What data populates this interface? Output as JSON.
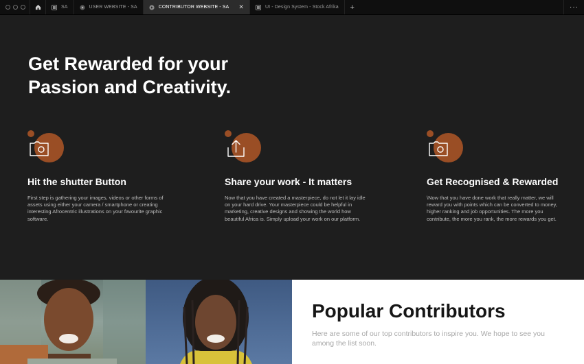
{
  "tabbar": {
    "tabs": [
      {
        "label": "SA",
        "icon": "figma-file-icon",
        "active": false
      },
      {
        "label": "USER WEBSITE - SA",
        "icon": "play-icon",
        "active": false
      },
      {
        "label": "CONTRIBUTOR WEBSITE - SA",
        "icon": "play-icon",
        "active": true
      },
      {
        "label": "UI - Design System - Stock Afrika",
        "icon": "figma-file-icon",
        "active": false
      }
    ],
    "new_tab": "+",
    "more": "···"
  },
  "hero": {
    "title_line1": "Get Rewarded for your",
    "title_line2": "Passion and Creativity.",
    "accent_color": "#9a4e25"
  },
  "features": [
    {
      "icon": "camera-icon",
      "title": "Hit the shutter Button",
      "text": "First step is gathering your images, videos or other forms of assets using either your camera / smartphone or creating interesting Afrocentric illustrations on your favourite graphic software."
    },
    {
      "icon": "upload-icon",
      "title": "Share your work - It matters",
      "text": "Now that you have created a masterpiece, do not let it lay idle on your hard drive. Your masterpiece could be helpful in marketing, creative designs and showing the world how beautiful Africa is. Simply upload your work on our platform."
    },
    {
      "icon": "camera-icon",
      "title": "Get Recognised & Rewarded",
      "text": "\\Now that you have done work that really matter, we will reward you with points which can be converted to money, higher ranking and job opportunities. The more you contribute, the more you rank, the more rewards you get."
    }
  ],
  "popular": {
    "title": "Popular Contributors",
    "text": "Here are some of our top contributors to inspire you. We hope to see you among the list soon."
  }
}
